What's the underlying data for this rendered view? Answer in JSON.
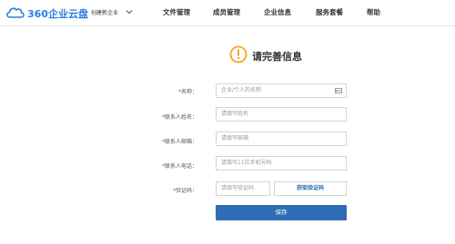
{
  "header": {
    "logo_text": "360企业云盘",
    "create_label": "创建新企业",
    "nav": [
      "文件管理",
      "成员管理",
      "企业信息",
      "服务套餐",
      "帮助"
    ]
  },
  "page": {
    "title": "请完善信息"
  },
  "form": {
    "fields": [
      {
        "label": "名称：",
        "placeholder": "企业/个人的名称",
        "required": true
      },
      {
        "label": "联系人姓名：",
        "placeholder": "请填写姓名",
        "required": true
      },
      {
        "label": "联系人邮箱：",
        "placeholder": "请填写邮箱",
        "required": true
      },
      {
        "label": "联系人电话：",
        "placeholder": "请填写11位手机号码",
        "required": true
      },
      {
        "label": "验证码：",
        "placeholder": "请填写验证码",
        "required": true
      }
    ],
    "get_code_label": "获取验证码",
    "save_label": "保存"
  },
  "colors": {
    "brand": "#2a7de1",
    "alert": "#f5a623",
    "button": "#2f6db5",
    "required": "#e33333"
  }
}
